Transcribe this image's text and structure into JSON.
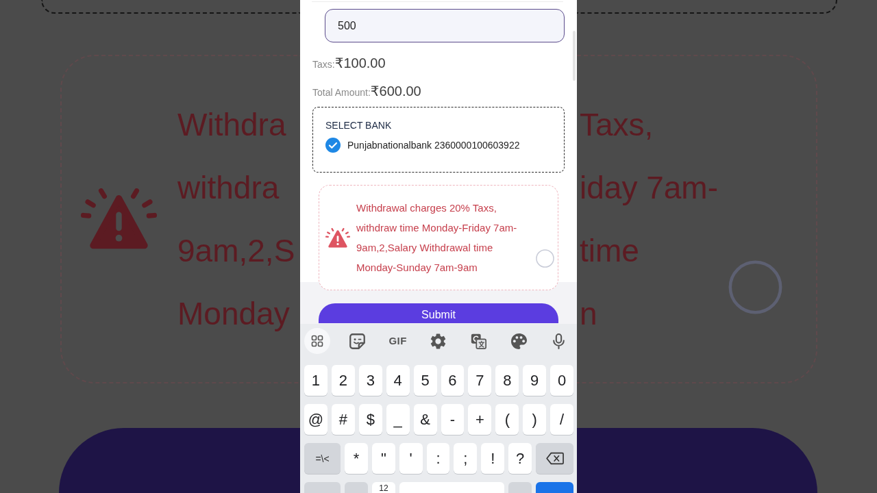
{
  "backdrop": {
    "left_lines": [
      "Withdra",
      "withdra",
      "9am,2,S",
      "Monday"
    ],
    "right_lines": [
      "Taxs,",
      "iday 7am-",
      "time",
      "n"
    ]
  },
  "withdraw_form": {
    "amount_field": {
      "value": "500"
    },
    "taxes": {
      "label": "Taxs:",
      "value": "₹100.00"
    },
    "total": {
      "label": "Total Amount:",
      "value": "₹600.00"
    },
    "bank_select": {
      "title": "SELECT BANK",
      "banks": [
        {
          "label": "Punjabnationalbank 2360000100603922",
          "selected": true
        }
      ]
    },
    "notice": {
      "text": "Withdrawal charges 20% Taxs, withdraw time Monday-Friday 7am-9am,2,Salary Withdrawal time Monday-Sunday 7am-9am",
      "checked": false
    },
    "submit_button": {
      "label": "Submit"
    }
  },
  "keyboard": {
    "gif_label": "GIF",
    "rows": [
      {
        "keys": [
          {
            "kind": "char",
            "label": "1"
          },
          {
            "kind": "char",
            "label": "2"
          },
          {
            "kind": "char",
            "label": "3"
          },
          {
            "kind": "char",
            "label": "4"
          },
          {
            "kind": "char",
            "label": "5"
          },
          {
            "kind": "char",
            "label": "6"
          },
          {
            "kind": "char",
            "label": "7"
          },
          {
            "kind": "char",
            "label": "8"
          },
          {
            "kind": "char",
            "label": "9"
          },
          {
            "kind": "char",
            "label": "0"
          }
        ]
      },
      {
        "keys": [
          {
            "kind": "char",
            "label": "@"
          },
          {
            "kind": "char",
            "label": "#"
          },
          {
            "kind": "char",
            "label": "$"
          },
          {
            "kind": "char",
            "label": "_"
          },
          {
            "kind": "char",
            "label": "&"
          },
          {
            "kind": "char",
            "label": "-"
          },
          {
            "kind": "char",
            "label": "+"
          },
          {
            "kind": "char",
            "label": "("
          },
          {
            "kind": "char",
            "label": ")"
          },
          {
            "kind": "char",
            "label": "/"
          }
        ]
      },
      {
        "keys": [
          {
            "kind": "mode",
            "label": "=\\<"
          },
          {
            "kind": "char",
            "label": "*"
          },
          {
            "kind": "char",
            "label": "\""
          },
          {
            "kind": "char",
            "label": "'"
          },
          {
            "kind": "char",
            "label": ":"
          },
          {
            "kind": "char",
            "label": ";"
          },
          {
            "kind": "char",
            "label": "!"
          },
          {
            "kind": "char",
            "label": "?"
          },
          {
            "kind": "backspace"
          }
        ]
      },
      {
        "keys": [
          {
            "kind": "mode"
          },
          {
            "kind": "function"
          },
          {
            "kind": "char",
            "label": "12"
          },
          {
            "kind": "space"
          },
          {
            "kind": "function"
          },
          {
            "kind": "enter"
          }
        ]
      }
    ]
  }
}
